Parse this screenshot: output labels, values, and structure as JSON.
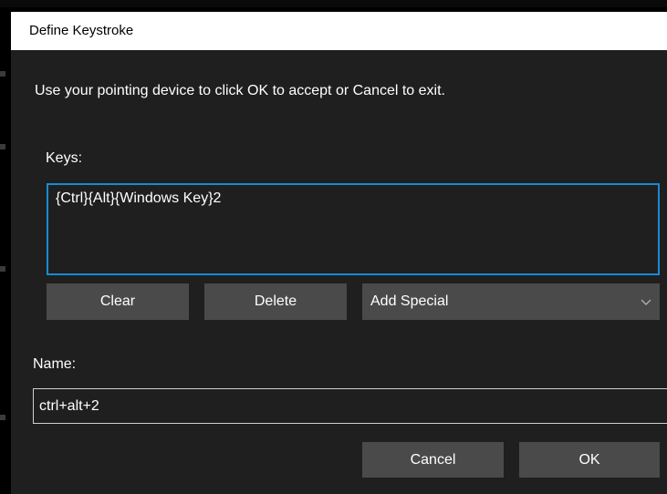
{
  "dialog": {
    "title": "Define Keystroke",
    "instruction": "Use your pointing device to click OK to accept or Cancel to exit."
  },
  "keys": {
    "label": "Keys:",
    "value": "{Ctrl}{Alt}{Windows Key}2"
  },
  "key_buttons": {
    "clear_label": "Clear",
    "delete_label": "Delete"
  },
  "add_special": {
    "selected": "Add Special",
    "icon": "chevron-down-icon"
  },
  "name": {
    "label": "Name:",
    "value": "ctrl+alt+2"
  },
  "actions": {
    "cancel_label": "Cancel",
    "ok_label": "OK"
  },
  "colors": {
    "dialog_background": "#1f1f1f",
    "button_background": "#4a4a4a",
    "focus_border": "#1a8ad4",
    "titlebar_background": "#ffffff",
    "text": "#ffffff"
  }
}
